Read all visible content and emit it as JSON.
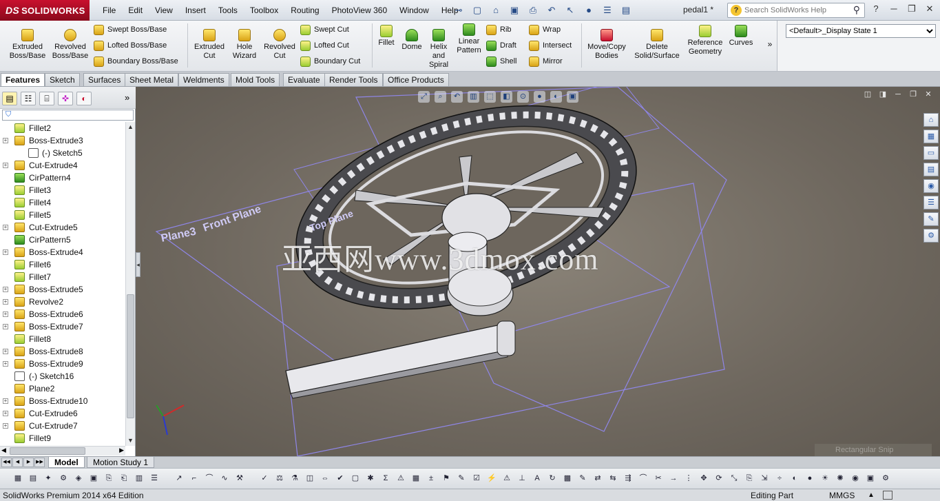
{
  "app": {
    "logo_prefix": "DS",
    "logo_text": "SOLIDWORKS",
    "document_name": "pedal1 *",
    "search_placeholder": "Search SolidWorks Help"
  },
  "menu": [
    "File",
    "Edit",
    "View",
    "Insert",
    "Tools",
    "Toolbox",
    "Routing",
    "PhotoView 360",
    "Window",
    "Help"
  ],
  "command_manager": {
    "large_buttons": [
      {
        "id": "extruded-boss-base",
        "line1": "Extruded",
        "line2": "Boss/Base",
        "icon": "extrude-icon"
      },
      {
        "id": "revolved-boss-base",
        "line1": "Revolved",
        "line2": "Boss/Base",
        "icon": "revolve-icon"
      },
      {
        "id": "extruded-cut",
        "line1": "Extruded",
        "line2": "Cut",
        "icon": "cut-extrude-icon"
      },
      {
        "id": "hole-wizard",
        "line1": "Hole",
        "line2": "Wizard",
        "icon": "hole-wizard-icon"
      },
      {
        "id": "revolved-cut",
        "line1": "Revolved",
        "line2": "Cut",
        "icon": "revolve-cut-icon"
      },
      {
        "id": "fillet",
        "line1": "Fillet",
        "line2": "",
        "icon": "fillet-icon"
      },
      {
        "id": "dome",
        "line1": "Dome",
        "line2": "",
        "icon": "dome-icon"
      },
      {
        "id": "helix-spiral",
        "line1": "Helix",
        "line2": "and",
        "line3": "Spiral",
        "icon": "helix-icon"
      },
      {
        "id": "linear-pattern",
        "line1": "Linear",
        "line2": "Pattern",
        "icon": "linear-pattern-icon"
      },
      {
        "id": "move-copy-bodies",
        "line1": "Move/Copy",
        "line2": "Bodies",
        "icon": "move-copy-icon"
      },
      {
        "id": "delete-solid-surface",
        "line1": "Delete",
        "line2": "Solid/Surface",
        "icon": "delete-body-icon"
      },
      {
        "id": "reference-geometry",
        "line1": "Reference",
        "line2": "Geometry",
        "icon": "reference-geometry-icon"
      },
      {
        "id": "curves",
        "line1": "Curves",
        "line2": "",
        "icon": "curves-icon"
      }
    ],
    "small_col1": [
      "Swept Boss/Base",
      "Lofted Boss/Base",
      "Boundary Boss/Base"
    ],
    "small_col2": [
      "Swept Cut",
      "Lofted Cut",
      "Boundary Cut"
    ],
    "small_col3": [
      "Rib",
      "Draft",
      "Shell"
    ],
    "small_col4": [
      "Wrap",
      "Intersect",
      "Mirror"
    ],
    "display_state": "<Default>_Display State 1"
  },
  "tabs": [
    "Features",
    "Sketch",
    "Surfaces",
    "Sheet Metal",
    "Weldments",
    "Mold Tools",
    "Evaluate",
    "Render Tools",
    "Office Products"
  ],
  "feature_tree": [
    {
      "label": "Fillet2",
      "icon": "fillet-icon",
      "expand": false,
      "sub": false
    },
    {
      "label": "Boss-Extrude3",
      "icon": "extrude-icon",
      "expand": true,
      "sub": false
    },
    {
      "label": "(-) Sketch5",
      "icon": "sketch-icon",
      "expand": false,
      "sub": true
    },
    {
      "label": "Cut-Extrude4",
      "icon": "cut-extrude-icon",
      "expand": true,
      "sub": false
    },
    {
      "label": "CirPattern4",
      "icon": "circular-pattern-icon",
      "expand": false,
      "sub": false
    },
    {
      "label": "Fillet3",
      "icon": "fillet-icon",
      "expand": false,
      "sub": false
    },
    {
      "label": "Fillet4",
      "icon": "fillet-icon",
      "expand": false,
      "sub": false
    },
    {
      "label": "Fillet5",
      "icon": "fillet-icon",
      "expand": false,
      "sub": false
    },
    {
      "label": "Cut-Extrude5",
      "icon": "cut-extrude-icon",
      "expand": true,
      "sub": false
    },
    {
      "label": "CirPattern5",
      "icon": "circular-pattern-icon",
      "expand": false,
      "sub": false
    },
    {
      "label": "Boss-Extrude4",
      "icon": "extrude-icon",
      "expand": true,
      "sub": false
    },
    {
      "label": "Fillet6",
      "icon": "fillet-icon",
      "expand": false,
      "sub": false
    },
    {
      "label": "Fillet7",
      "icon": "fillet-icon",
      "expand": false,
      "sub": false
    },
    {
      "label": "Boss-Extrude5",
      "icon": "extrude-icon",
      "expand": true,
      "sub": false
    },
    {
      "label": "Revolve2",
      "icon": "revolve-icon",
      "expand": true,
      "sub": false
    },
    {
      "label": "Boss-Extrude6",
      "icon": "extrude-icon",
      "expand": true,
      "sub": false
    },
    {
      "label": "Boss-Extrude7",
      "icon": "extrude-icon",
      "expand": true,
      "sub": false
    },
    {
      "label": "Fillet8",
      "icon": "fillet-icon",
      "expand": false,
      "sub": false
    },
    {
      "label": "Boss-Extrude8",
      "icon": "extrude-icon",
      "expand": true,
      "sub": false
    },
    {
      "label": "Boss-Extrude9",
      "icon": "extrude-icon",
      "expand": true,
      "sub": false
    },
    {
      "label": "(-) Sketch16",
      "icon": "sketch-icon",
      "expand": false,
      "sub": false
    },
    {
      "label": "Plane2",
      "icon": "plane-icon",
      "expand": false,
      "sub": false
    },
    {
      "label": "Boss-Extrude10",
      "icon": "extrude-icon",
      "expand": true,
      "sub": false
    },
    {
      "label": "Cut-Extrude6",
      "icon": "cut-extrude-icon",
      "expand": true,
      "sub": false
    },
    {
      "label": "Cut-Extrude7",
      "icon": "cut-extrude-icon",
      "expand": true,
      "sub": false
    },
    {
      "label": "Fillet9",
      "icon": "fillet-icon",
      "expand": false,
      "sub": false
    }
  ],
  "viewport": {
    "plane_labels": [
      "Plane3",
      "Front Plane",
      "Top Plane"
    ],
    "watermark": "亚西网www.3dmox.com",
    "ghost_tooltip": "Rectangular Snip",
    "colors": {
      "background": "#6e675e",
      "plane_outline": "#8f86e8",
      "part": "#d8d8dc",
      "part_shadow": "#8a8a90"
    }
  },
  "bottom_tabs": [
    "Model",
    "Motion Study 1"
  ],
  "status": {
    "edition": "SolidWorks Premium 2014 x64 Edition",
    "mode": "Editing Part",
    "units": "MMGS"
  }
}
